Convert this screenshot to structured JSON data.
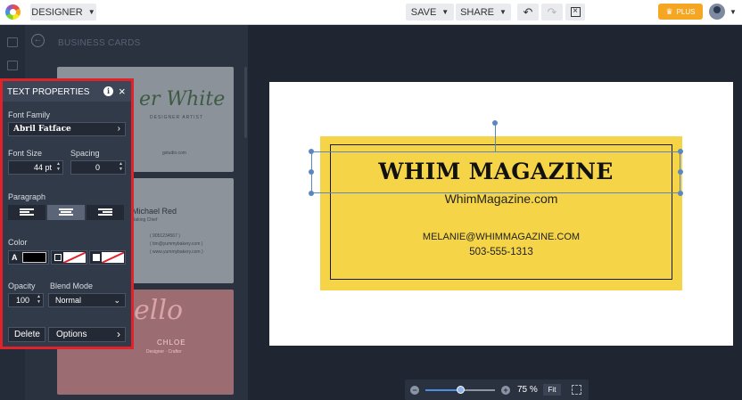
{
  "topbar": {
    "designer_label": "DESIGNER",
    "save_label": "SAVE",
    "share_label": "SHARE",
    "plus_label": "PLUS",
    "icons": [
      "logo-icon",
      "undo-icon",
      "redo-icon",
      "close-document-icon",
      "crown-icon",
      "user-avatar"
    ]
  },
  "template_panel": {
    "title": "BUSINESS CARDS",
    "cards": [
      {
        "name_fragment": "er White",
        "subtitle": "DESIGNER ARTIST",
        "detail": "gstudio.com"
      },
      {
        "name": "Michael Red",
        "role": "Baking Chief",
        "lines": [
          "( 9051234567 )",
          "( tim@yummybakery.com )",
          "( www.yummybakery.com )"
        ]
      },
      {
        "script": "ello",
        "name": "CHLOE",
        "sub": "Designer · Crafter"
      }
    ]
  },
  "props": {
    "title": "TEXT PROPERTIES",
    "font_family_label": "Font Family",
    "font_family_value": "Abril Fatface",
    "font_size_label": "Font Size",
    "font_size_value": "44 pt",
    "spacing_label": "Spacing",
    "spacing_value": "0",
    "paragraph_label": "Paragraph",
    "paragraph_selected": "center",
    "color_label": "Color",
    "color_letter": "A",
    "text_color": "#000000",
    "opacity_label": "Opacity",
    "opacity_value": "100",
    "blend_label": "Blend Mode",
    "blend_value": "Normal",
    "delete_label": "Delete",
    "options_label": "Options"
  },
  "card": {
    "headline": "WHIM MAGAZINE",
    "website": "WhimMagazine.com",
    "email": "MELANIE@WHIMMAGAZINE.COM",
    "phone": "503-555-1313",
    "background": "#f5d547"
  },
  "zoom": {
    "value_label": "75 %",
    "fit_label": "Fit",
    "level": 0.5
  },
  "colors": {
    "accent_blue": "#5b87bf",
    "plus_orange": "#f5a623",
    "highlight_red": "#e0222a"
  }
}
